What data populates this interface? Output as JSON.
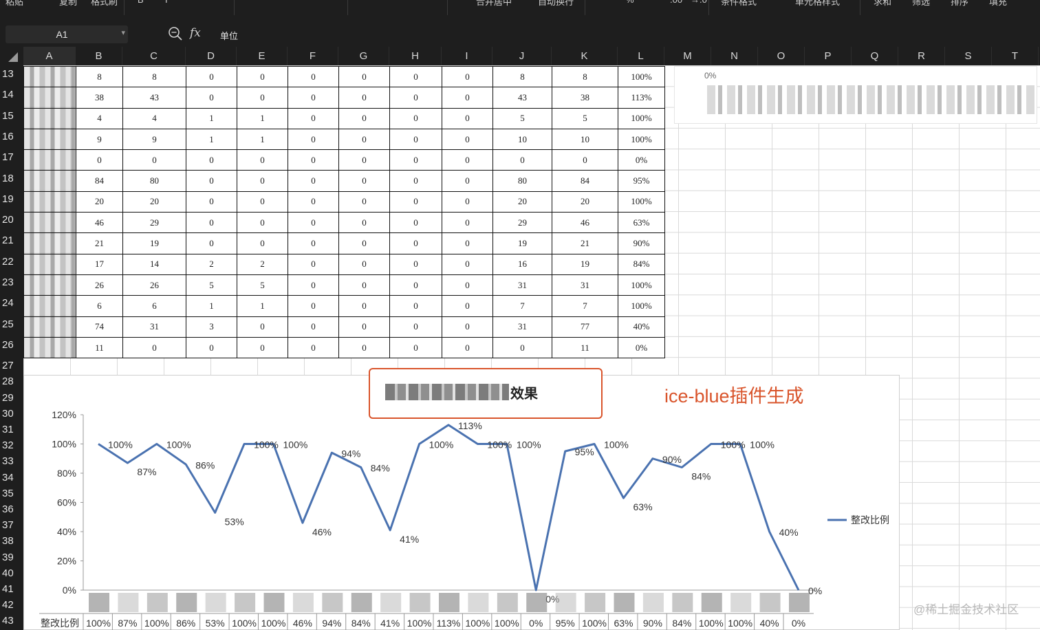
{
  "toolbar": {
    "items": [
      "粘贴",
      "复制",
      "格式刷",
      "合并居中",
      "自动换行",
      "条件格式",
      "单元格样式",
      "求和",
      "筛选",
      "排序",
      "填充"
    ],
    "percent_symbol": "%",
    "decimal_inc": ".00",
    "decimal_dec": "→.0"
  },
  "formula_bar": {
    "cell_ref": "A1",
    "fx": "fx",
    "content": "单位"
  },
  "columns": [
    "A",
    "B",
    "C",
    "D",
    "E",
    "F",
    "G",
    "H",
    "I",
    "J",
    "K",
    "L",
    "M",
    "N",
    "O",
    "P",
    "Q",
    "R",
    "S",
    "T"
  ],
  "rows": [
    "13",
    "14",
    "15",
    "16",
    "17",
    "18",
    "19",
    "20",
    "21",
    "22",
    "23",
    "24",
    "25",
    "26",
    "27",
    "28",
    "29",
    "30",
    "31",
    "32",
    "33",
    "34",
    "35",
    "36",
    "37",
    "38",
    "39",
    "40",
    "41",
    "42",
    "43"
  ],
  "table": [
    [
      "8",
      "8",
      "0",
      "0",
      "0",
      "0",
      "0",
      "0",
      "8",
      "8",
      "100%"
    ],
    [
      "38",
      "43",
      "0",
      "0",
      "0",
      "0",
      "0",
      "0",
      "43",
      "38",
      "113%"
    ],
    [
      "4",
      "4",
      "1",
      "1",
      "0",
      "0",
      "0",
      "0",
      "5",
      "5",
      "100%"
    ],
    [
      "9",
      "9",
      "1",
      "1",
      "0",
      "0",
      "0",
      "0",
      "10",
      "10",
      "100%"
    ],
    [
      "0",
      "0",
      "0",
      "0",
      "0",
      "0",
      "0",
      "0",
      "0",
      "0",
      "0%"
    ],
    [
      "84",
      "80",
      "0",
      "0",
      "0",
      "0",
      "0",
      "0",
      "80",
      "84",
      "95%"
    ],
    [
      "20",
      "20",
      "0",
      "0",
      "0",
      "0",
      "0",
      "0",
      "20",
      "20",
      "100%"
    ],
    [
      "46",
      "29",
      "0",
      "0",
      "0",
      "0",
      "0",
      "0",
      "29",
      "46",
      "63%"
    ],
    [
      "21",
      "19",
      "0",
      "0",
      "0",
      "0",
      "0",
      "0",
      "19",
      "21",
      "90%"
    ],
    [
      "17",
      "14",
      "2",
      "2",
      "0",
      "0",
      "0",
      "0",
      "16",
      "19",
      "84%"
    ],
    [
      "26",
      "26",
      "5",
      "5",
      "0",
      "0",
      "0",
      "0",
      "31",
      "31",
      "100%"
    ],
    [
      "6",
      "6",
      "1",
      "1",
      "0",
      "0",
      "0",
      "0",
      "7",
      "7",
      "100%"
    ],
    [
      "74",
      "31",
      "3",
      "0",
      "0",
      "0",
      "0",
      "0",
      "31",
      "77",
      "40%"
    ],
    [
      "11",
      "0",
      "0",
      "0",
      "0",
      "0",
      "0",
      "0",
      "0",
      "11",
      "0%"
    ]
  ],
  "mini_chart_label": "0%",
  "annotation": "ice-blue插件生成",
  "watermark": "@稀土掘金技术社区",
  "chart_data": {
    "type": "line",
    "title": "效果",
    "series": [
      {
        "name": "整改比例",
        "values": [
          100,
          87,
          100,
          86,
          53,
          100,
          100,
          46,
          94,
          84,
          41,
          100,
          113,
          100,
          100,
          0,
          95,
          100,
          63,
          90,
          84,
          100,
          100,
          40,
          0
        ]
      }
    ],
    "data_labels": [
      "100%",
      "87%",
      "100%",
      "86%",
      "53%",
      "100%",
      "100%",
      "46%",
      "94%",
      "84%",
      "41%",
      "100%",
      "113%",
      "100%",
      "100%",
      "0%",
      "95%",
      "100%",
      "63%",
      "90%",
      "84%",
      "100%",
      "100%",
      "40%",
      "0%"
    ],
    "y_ticks": [
      "0%",
      "20%",
      "40%",
      "60%",
      "80%",
      "100%",
      "120%"
    ],
    "ylim": [
      0,
      120
    ],
    "legend": "right",
    "data_table_label": "整改比例",
    "color": "#4a72b0"
  }
}
